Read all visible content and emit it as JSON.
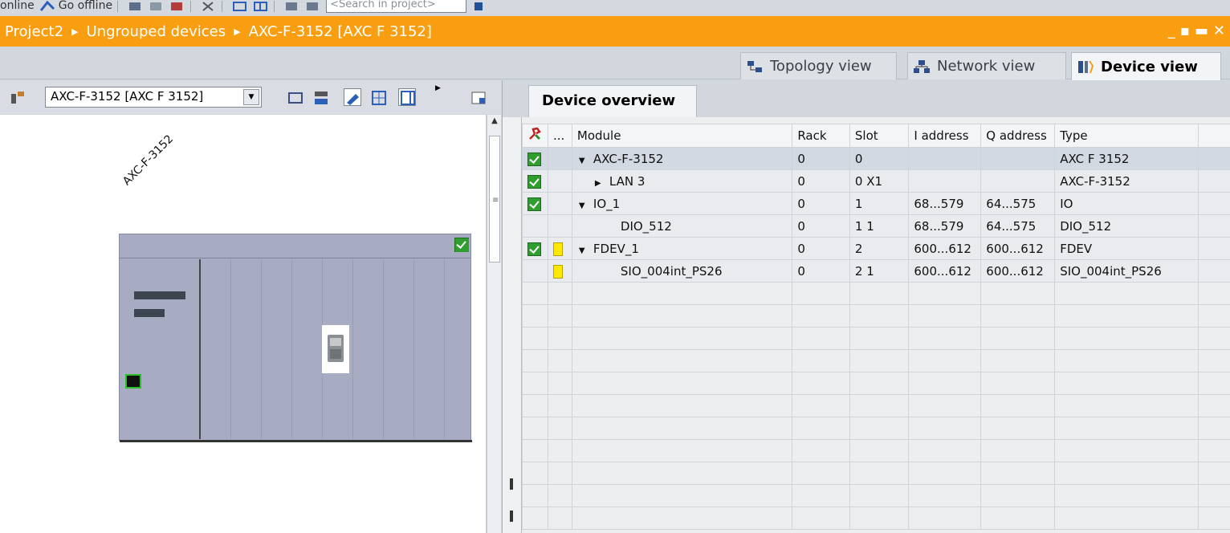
{
  "toolbar": {
    "go_online_prefix": "online",
    "go_online_label": "Go offline",
    "search_placeholder": "<Search in project>"
  },
  "breadcrumb": {
    "items": [
      "Project2",
      "Ungrouped devices",
      "AXC-F-3152 [AXC F 3152]"
    ]
  },
  "window_controls": {
    "minimize": "_",
    "restore": "▪",
    "maximize": "▬",
    "close": "✕"
  },
  "view_tabs": [
    {
      "label": "Topology view",
      "icon": "topology-icon",
      "active": false
    },
    {
      "label": "Network view",
      "icon": "network-icon",
      "active": false
    },
    {
      "label": "Device view",
      "icon": "device-icon",
      "active": true
    }
  ],
  "left_panel": {
    "device_select_value": "AXC-F-3152 [AXC F 3152]",
    "device_label": "AXC-F-3152"
  },
  "device_overview": {
    "tab_label": "Device overview",
    "columns": {
      "diag": "",
      "more": "...",
      "module": "Module",
      "rack": "Rack",
      "slot": "Slot",
      "iaddr": "I address",
      "qaddr": "Q address",
      "type": "Type"
    },
    "rows": [
      {
        "ok": true,
        "warn": false,
        "expander": "▼",
        "indent": 0,
        "module": "AXC-F-3152",
        "rack": "0",
        "slot": "0",
        "iaddr": "",
        "qaddr": "",
        "type": "AXC F 3152"
      },
      {
        "ok": true,
        "warn": false,
        "expander": "▶",
        "indent": 1,
        "module": "LAN 3",
        "rack": "0",
        "slot": "0 X1",
        "iaddr": "",
        "qaddr": "",
        "type": "AXC-F-3152"
      },
      {
        "ok": true,
        "warn": false,
        "expander": "▼",
        "indent": 0,
        "module": "IO_1",
        "rack": "0",
        "slot": "1",
        "iaddr": "68...579",
        "qaddr": "64...575",
        "type": "IO"
      },
      {
        "ok": false,
        "warn": false,
        "expander": "",
        "indent": 2,
        "module": "DIO_512",
        "rack": "0",
        "slot": "1 1",
        "iaddr": "68...579",
        "qaddr": "64...575",
        "type": "DIO_512"
      },
      {
        "ok": true,
        "warn": true,
        "expander": "▼",
        "indent": 0,
        "module": "FDEV_1",
        "rack": "0",
        "slot": "2",
        "iaddr": "600...612",
        "qaddr": "600...612",
        "type": "FDEV"
      },
      {
        "ok": false,
        "warn": true,
        "expander": "",
        "indent": 2,
        "module": "SIO_004int_PS26",
        "rack": "0",
        "slot": "2 1",
        "iaddr": "600...612",
        "qaddr": "600...612",
        "type": "SIO_004int_PS26"
      }
    ]
  },
  "colors": {
    "accent": "#f89e10",
    "ok": "#2f9e2f",
    "warn": "#ffe800"
  }
}
